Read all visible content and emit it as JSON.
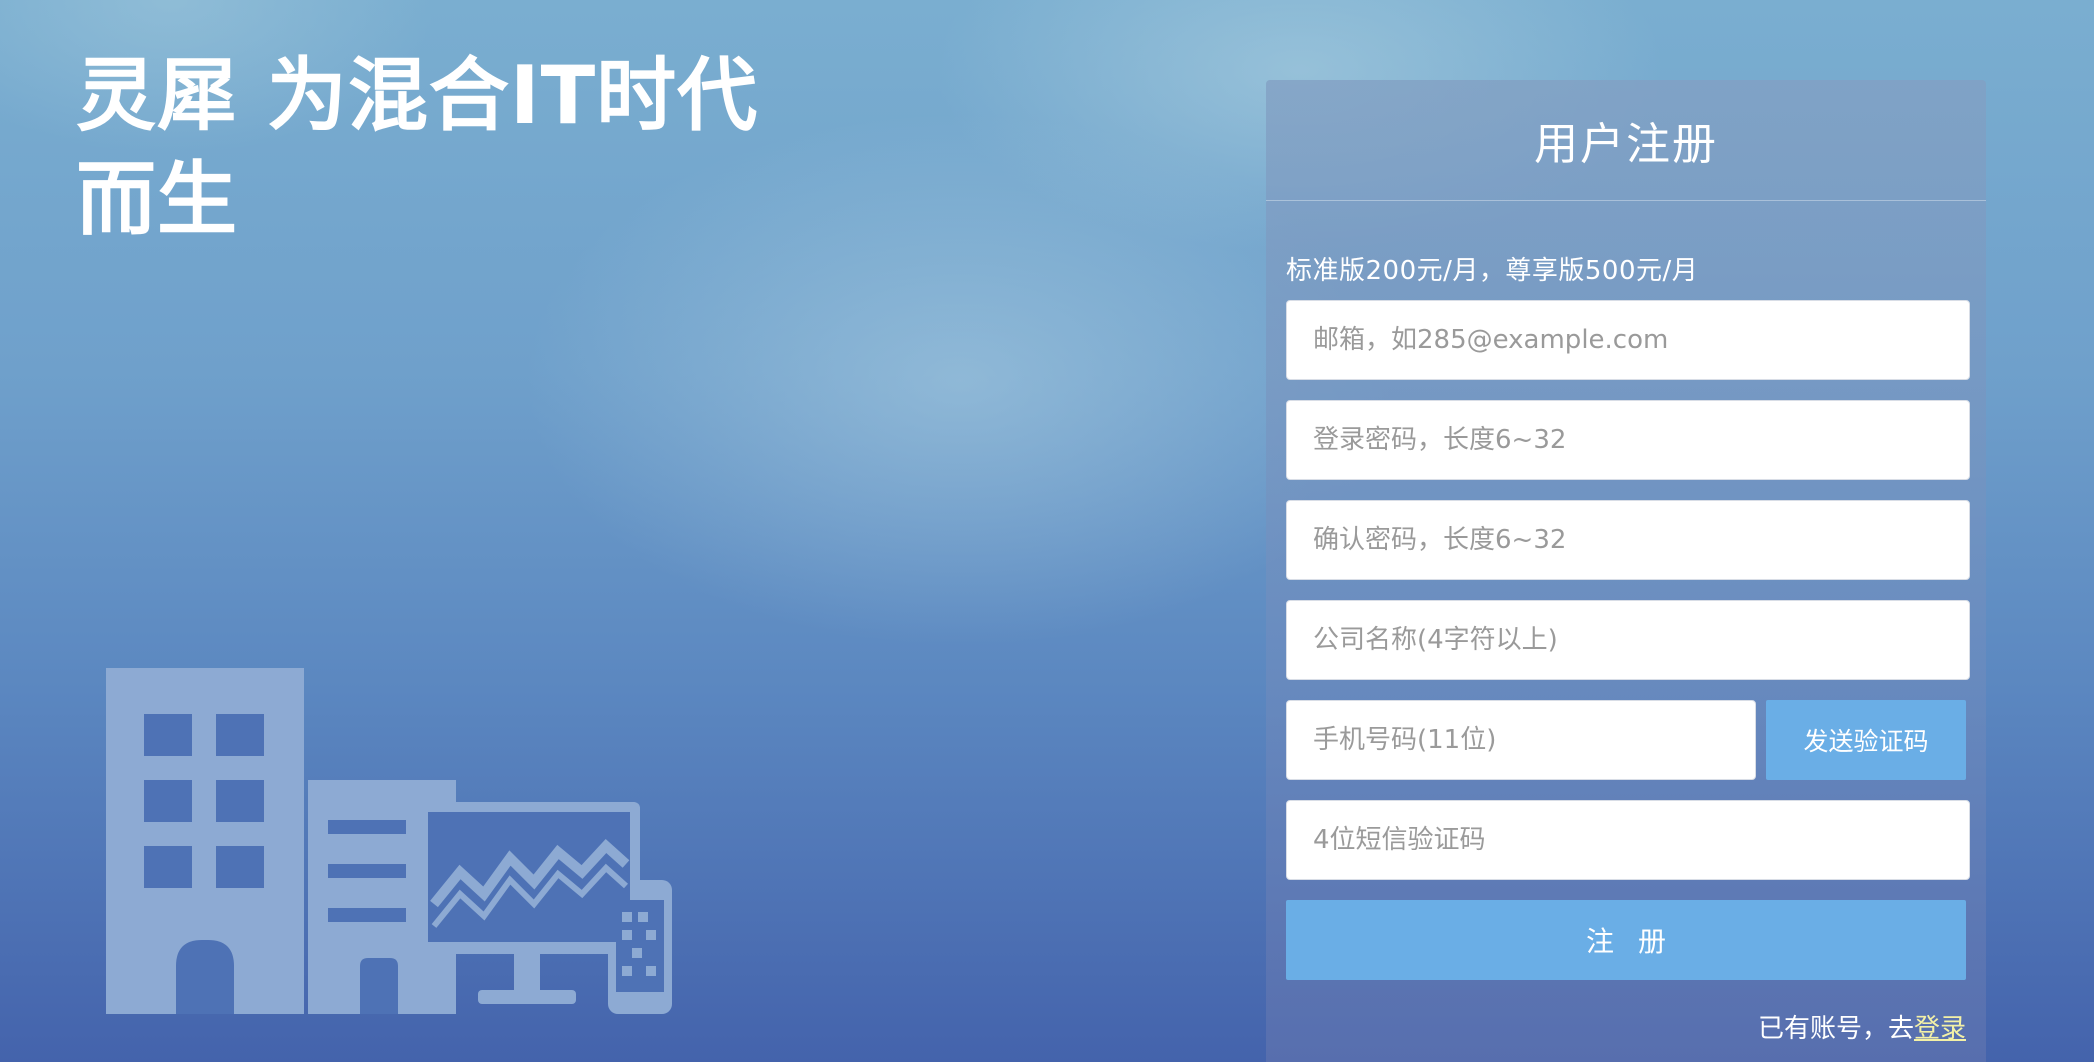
{
  "hero": {
    "headline_line1": "灵犀 为混合IT时代",
    "headline_line2": "而生"
  },
  "illustration": {
    "icon": "buildings-monitor-phone-illustration",
    "color": "#8daad3"
  },
  "register": {
    "title": "用户注册",
    "pricing": "标准版200元/月，尊享版500元/月",
    "fields": {
      "email_placeholder": "邮箱，如285@example.com",
      "password_placeholder": "登录密码，长度6~32",
      "confirm_placeholder": "确认密码，长度6~32",
      "company_placeholder": "公司名称(4字符以上)",
      "phone_placeholder": "手机号码(11位)",
      "sms_placeholder": "4位短信验证码"
    },
    "send_code_label": "发送验证码",
    "submit_label": "注册",
    "have_account_text": "已有账号，去",
    "login_link_label": "登录"
  },
  "colors": {
    "accent_button": "#6aaee6",
    "link": "#f3f0a6"
  }
}
